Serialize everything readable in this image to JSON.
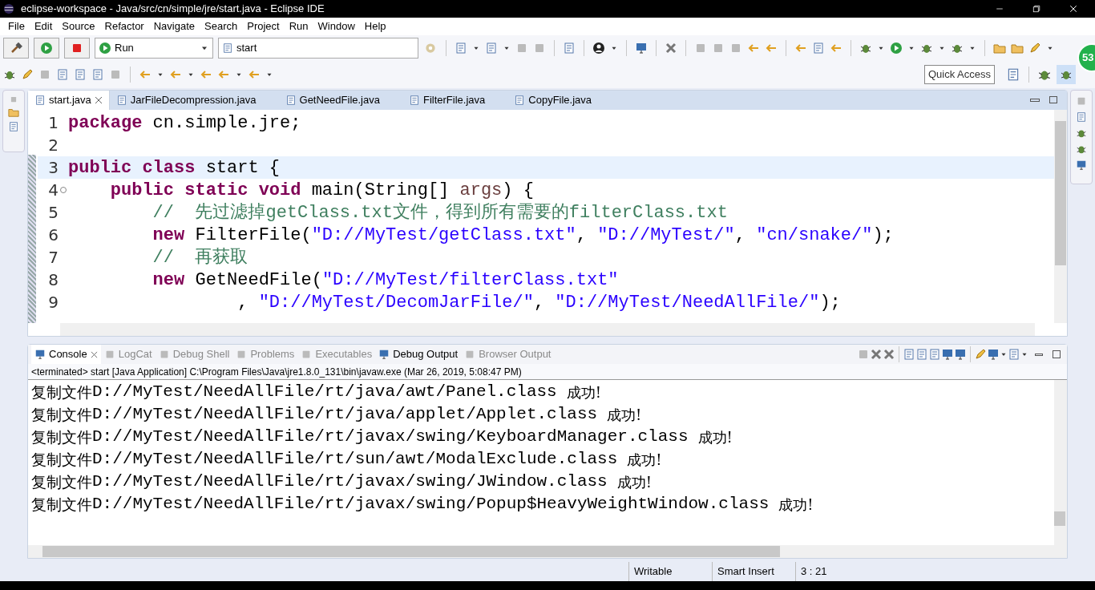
{
  "window": {
    "title": "eclipse-workspace - Java/src/cn/simple/jre/start.java - Eclipse IDE"
  },
  "menu": [
    "File",
    "Edit",
    "Source",
    "Refactor",
    "Navigate",
    "Search",
    "Project",
    "Run",
    "Window",
    "Help"
  ],
  "toolbar": {
    "run_config": "Run",
    "launch_target": "start",
    "quick_access": "Quick Access",
    "badge": "53"
  },
  "editor_tabs": [
    {
      "label": "start.java",
      "selected": true,
      "closable": true
    },
    {
      "label": "JarFileDecompression.java",
      "selected": false,
      "closable": false
    },
    {
      "label": "GetNeedFile.java",
      "selected": false,
      "closable": false
    },
    {
      "label": "FilterFile.java",
      "selected": false,
      "closable": false
    },
    {
      "label": "CopyFile.java",
      "selected": false,
      "closable": false
    }
  ],
  "code": [
    {
      "number": "1",
      "current": false,
      "fold": false,
      "tokens": [
        {
          "kind": "keyword",
          "text": "package"
        },
        {
          "kind": "plain",
          "text": " cn.simple.jre;"
        }
      ]
    },
    {
      "number": "2",
      "current": false,
      "fold": false
    },
    {
      "number": "3",
      "current": true,
      "fold": false,
      "tokens": [
        {
          "kind": "keyword",
          "text": "public class"
        },
        {
          "kind": "plain",
          "text": " start {"
        }
      ]
    },
    {
      "number": "4",
      "current": false,
      "fold": true,
      "tokens": [
        {
          "kind": "keyword",
          "text": "    public static void"
        },
        {
          "kind": "plain",
          "text": " main(String[] "
        },
        {
          "kind": "param",
          "text": "args"
        },
        {
          "kind": "plain",
          "text": ") {"
        }
      ]
    },
    {
      "number": "5",
      "current": false,
      "fold": false,
      "tokens": [
        {
          "kind": "comment",
          "text": "        //  先过滤掉getClass.txt文件，得到所有需要的filterClass.txt"
        }
      ]
    },
    {
      "number": "6",
      "current": false,
      "fold": false,
      "tokens": [
        {
          "kind": "keyword",
          "text": "        new"
        },
        {
          "kind": "plain",
          "text": " FilterFile("
        },
        {
          "kind": "string",
          "text": "\"D://MyTest/getClass.txt\""
        },
        {
          "kind": "plain",
          "text": ", "
        },
        {
          "kind": "string",
          "text": "\"D://MyTest/\""
        },
        {
          "kind": "plain",
          "text": ", "
        },
        {
          "kind": "string",
          "text": "\"cn/snake/\""
        },
        {
          "kind": "plain",
          "text": ");"
        }
      ]
    },
    {
      "number": "7",
      "current": false,
      "fold": false,
      "tokens": [
        {
          "kind": "comment",
          "text": "        //  再获取"
        }
      ]
    },
    {
      "number": "8",
      "current": false,
      "fold": false,
      "tokens": [
        {
          "kind": "keyword",
          "text": "        new"
        },
        {
          "kind": "plain",
          "text": " GetNeedFile("
        },
        {
          "kind": "string",
          "text": "\"D://MyTest/filterClass.txt\""
        }
      ]
    },
    {
      "number": "9",
      "current": false,
      "fold": false,
      "tokens": [
        {
          "kind": "plain",
          "text": "                , "
        },
        {
          "kind": "string",
          "text": "\"D://MyTest/DecomJarFile/\""
        },
        {
          "kind": "plain",
          "text": ", "
        },
        {
          "kind": "string",
          "text": "\"D://MyTest/NeedAllFile/\""
        },
        {
          "kind": "plain",
          "text": ");"
        }
      ]
    }
  ],
  "console_tabs": [
    {
      "label": "Console",
      "selected": true,
      "disabled": false,
      "closable": true
    },
    {
      "label": "LogCat",
      "selected": false,
      "disabled": true,
      "closable": false
    },
    {
      "label": "Debug Shell",
      "selected": false,
      "disabled": true,
      "closable": false
    },
    {
      "label": "Problems",
      "selected": false,
      "disabled": true,
      "closable": false
    },
    {
      "label": "Executables",
      "selected": false,
      "disabled": true,
      "closable": false
    },
    {
      "label": "Debug Output",
      "selected": false,
      "disabled": false,
      "closable": false
    },
    {
      "label": "Browser Output",
      "selected": false,
      "disabled": true,
      "closable": false
    }
  ],
  "console_status": "<terminated> start [Java Application] C:\\Program Files\\Java\\jre1.8.0_131\\bin\\javaw.exe (Mar 26, 2019, 5:08:47 PM)",
  "console_lines": [
    {
      "prefix": "复制文件",
      "path": "D://MyTest/NeedAllFile/rt/java/awt/Panel.class",
      "suffix": "成功!"
    },
    {
      "prefix": "复制文件",
      "path": "D://MyTest/NeedAllFile/rt/java/applet/Applet.class",
      "suffix": "成功!"
    },
    {
      "prefix": "复制文件",
      "path": "D://MyTest/NeedAllFile/rt/javax/swing/KeyboardManager.class",
      "suffix": "成功!"
    },
    {
      "prefix": "复制文件",
      "path": "D://MyTest/NeedAllFile/rt/sun/awt/ModalExclude.class",
      "suffix": "成功!"
    },
    {
      "prefix": "复制文件",
      "path": "D://MyTest/NeedAllFile/rt/javax/swing/JWindow.class",
      "suffix": "成功!"
    },
    {
      "prefix": "复制文件",
      "path": "D://MyTest/NeedAllFile/rt/javax/swing/Popup$HeavyWeightWindow.class",
      "suffix": "成功!"
    }
  ],
  "status_bar": [
    "Writable",
    "Smart Insert",
    "3 : 21"
  ]
}
